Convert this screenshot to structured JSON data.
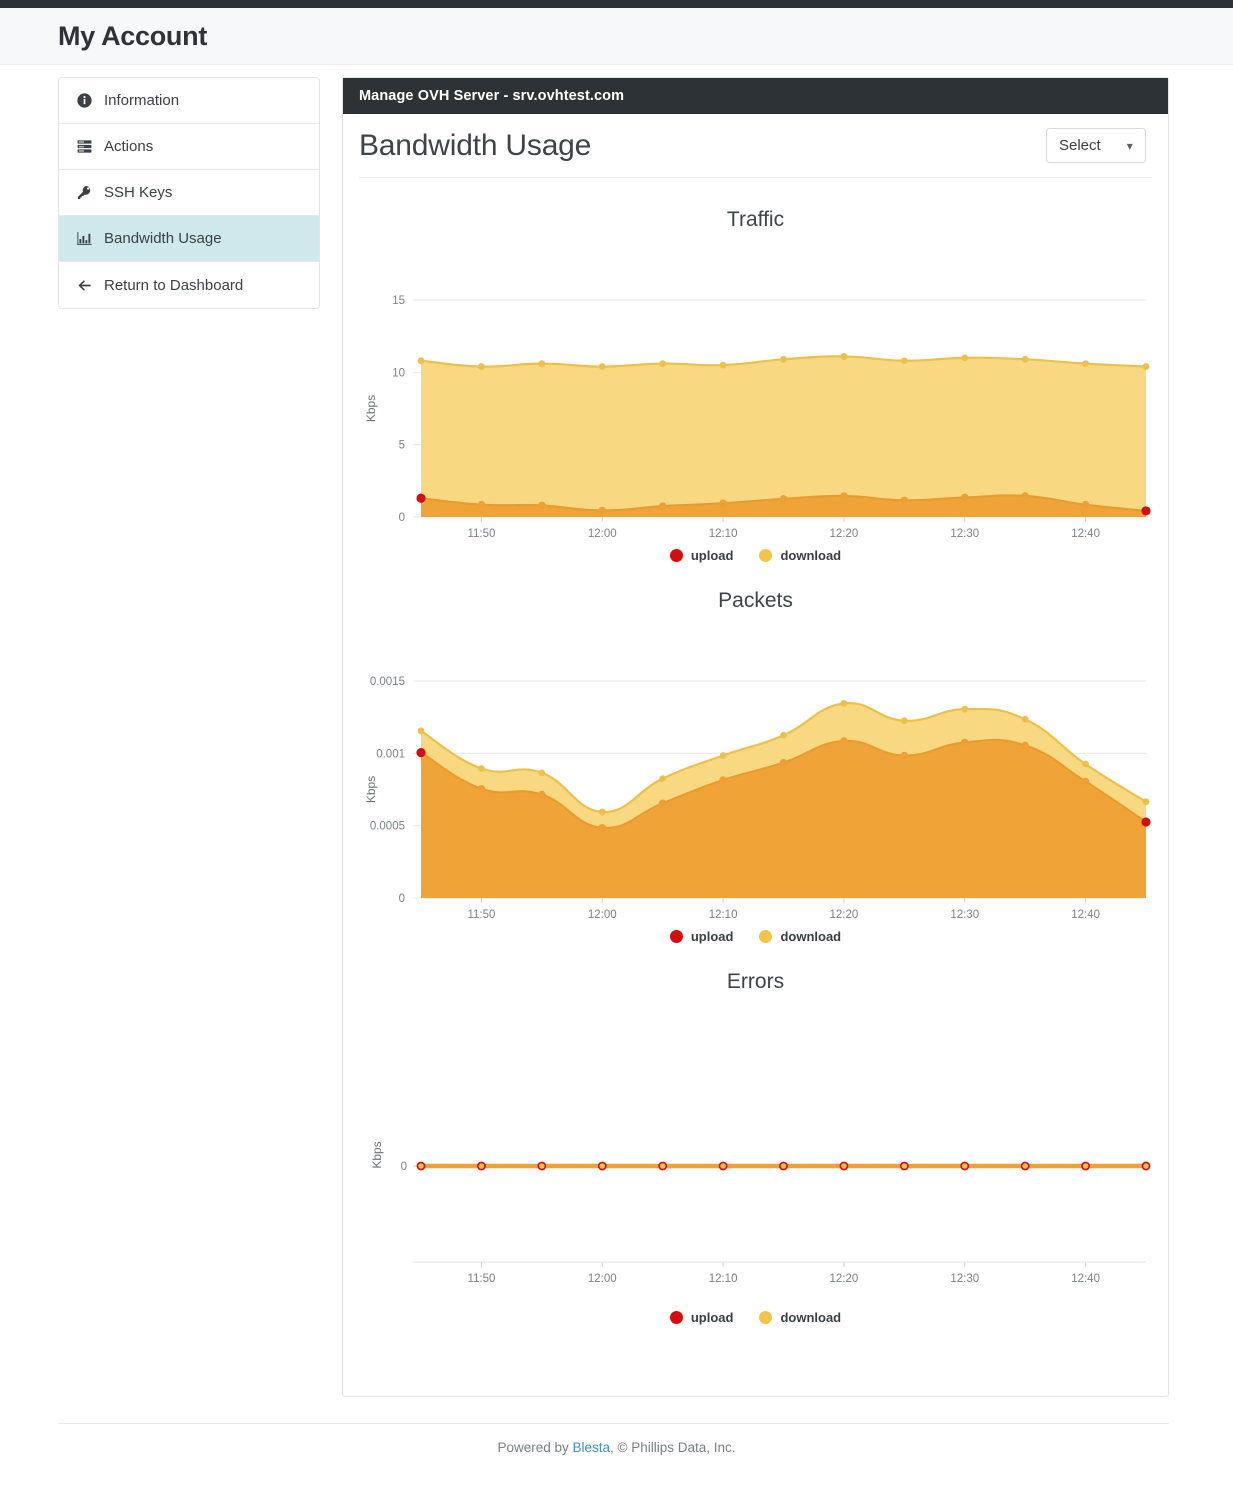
{
  "header": {
    "title": "My Account"
  },
  "sidebar": {
    "items": [
      {
        "label": "Information",
        "icon": "info-circle-icon",
        "active": false
      },
      {
        "label": "Actions",
        "icon": "server-stack-icon",
        "active": false
      },
      {
        "label": "SSH Keys",
        "icon": "key-icon",
        "active": false
      },
      {
        "label": "Bandwidth Usage",
        "icon": "bar-chart-icon",
        "active": true
      },
      {
        "label": "Return to Dashboard",
        "icon": "arrow-left-icon",
        "active": false
      }
    ]
  },
  "card": {
    "topbar_title": "Manage OVH Server - srv.ovhtest.com",
    "page_title": "Bandwidth Usage",
    "select": {
      "value": "Select",
      "caret": "chevron-down-icon"
    }
  },
  "legend": {
    "upload_label": "upload",
    "download_label": "download",
    "upload_color": "#d40d0d",
    "download_color": "#f2c548"
  },
  "colors": {
    "upload_area": "#efa135",
    "upload_line": "#eb9b2e",
    "download_area": "#f7d676",
    "download_line": "#edc04b",
    "marker_upload": "#ef9f33",
    "marker_download": "#edc04b",
    "endpoint_red": "#d40d0d",
    "grid": "#e6e8ea",
    "axis": "#cdd2d6"
  },
  "chart_data": [
    {
      "type": "area",
      "title": "Traffic",
      "ylabel": "Kbps",
      "xlabel": "",
      "ylim": [
        0,
        15
      ],
      "yticks": [
        0,
        5,
        10,
        15
      ],
      "ytick_labels": [
        "0",
        "5",
        "10",
        "15"
      ],
      "xticks": [
        "11:50",
        "12:00",
        "12:10",
        "12:20",
        "12:30",
        "12:40"
      ],
      "x": [
        "11:45",
        "11:50",
        "11:55",
        "12:00",
        "12:05",
        "12:10",
        "12:15",
        "12:20",
        "12:25",
        "12:30",
        "12:35",
        "12:40",
        "12:45"
      ],
      "grid": true,
      "legend_position": "bottom",
      "series": [
        {
          "name": "download",
          "values": [
            10.8,
            10.4,
            10.6,
            10.4,
            10.6,
            10.5,
            10.9,
            11.1,
            10.8,
            11.0,
            10.9,
            10.6,
            10.4
          ]
        },
        {
          "name": "upload",
          "values": [
            1.3,
            0.85,
            0.8,
            0.45,
            0.75,
            0.95,
            1.25,
            1.45,
            1.15,
            1.35,
            1.45,
            0.85,
            0.42
          ]
        }
      ]
    },
    {
      "type": "area",
      "title": "Packets",
      "ylabel": "Kbps",
      "xlabel": "",
      "ylim": [
        0,
        0.0015
      ],
      "yticks": [
        0,
        0.0005,
        0.001,
        0.0015
      ],
      "ytick_labels": [
        "0",
        "0.0005",
        "0.001",
        "0.0015"
      ],
      "xticks": [
        "11:50",
        "12:00",
        "12:10",
        "12:20",
        "12:30",
        "12:40"
      ],
      "x": [
        "11:45",
        "11:50",
        "11:55",
        "12:00",
        "12:05",
        "12:10",
        "12:15",
        "12:20",
        "12:25",
        "12:30",
        "12:35",
        "12:40",
        "12:45"
      ],
      "grid": true,
      "legend_position": "bottom",
      "series": [
        {
          "name": "download",
          "values": [
            0.001155,
            0.000895,
            0.000865,
            0.000595,
            0.000825,
            0.000985,
            0.001125,
            0.001345,
            0.001225,
            0.001305,
            0.001235,
            0.000925,
            0.000665
          ]
        },
        {
          "name": "upload",
          "values": [
            0.001005,
            0.000755,
            0.000715,
            0.000485,
            0.000655,
            0.000815,
            0.000935,
            0.001085,
            0.000985,
            0.001075,
            0.001055,
            0.000805,
            0.000525
          ]
        }
      ]
    },
    {
      "type": "line",
      "title": "Errors",
      "ylabel": "Kbps",
      "xlabel": "",
      "ylim": [
        0,
        0
      ],
      "yticks": [
        0
      ],
      "ytick_labels": [
        "0"
      ],
      "xticks": [
        "11:50",
        "12:00",
        "12:10",
        "12:20",
        "12:30",
        "12:40"
      ],
      "x": [
        "11:45",
        "11:50",
        "11:55",
        "12:00",
        "12:05",
        "12:10",
        "12:15",
        "12:20",
        "12:25",
        "12:30",
        "12:35",
        "12:40",
        "12:45"
      ],
      "grid": false,
      "legend_position": "bottom",
      "series": [
        {
          "name": "download",
          "values": [
            0,
            0,
            0,
            0,
            0,
            0,
            0,
            0,
            0,
            0,
            0,
            0,
            0
          ]
        },
        {
          "name": "upload",
          "values": [
            0,
            0,
            0,
            0,
            0,
            0,
            0,
            0,
            0,
            0,
            0,
            0,
            0
          ]
        }
      ]
    }
  ],
  "footer": {
    "prefix": "Powered by ",
    "link": "Blesta",
    "suffix": ", © Phillips Data, Inc."
  }
}
